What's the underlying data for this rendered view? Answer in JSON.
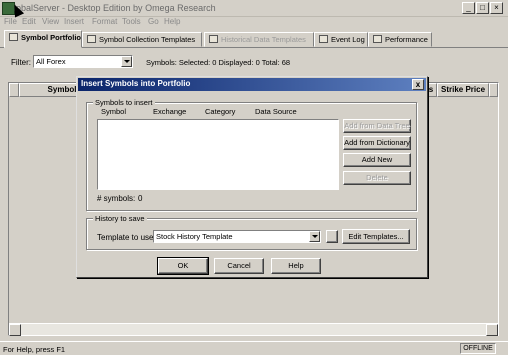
{
  "window": {
    "title": "lobalServer - Desktop Edition by Omega Research"
  },
  "menu": {
    "items": [
      "File",
      "Edit",
      "View",
      "Insert",
      "Format",
      "Tools",
      "Go",
      "Help"
    ]
  },
  "tabs": [
    {
      "label": "Symbol Portfolio",
      "active": true
    },
    {
      "label": "Symbol Collection Templates",
      "active": false
    },
    {
      "label": "Historical Data Templates",
      "active": false
    },
    {
      "label": "Event Log",
      "active": false
    },
    {
      "label": "Performance",
      "active": false
    }
  ],
  "filter": {
    "label": "Filter:",
    "value": "All Forex",
    "counts": "Symbols: Selected: 0   Displayed: 0   Total: 68"
  },
  "grid": {
    "columns": [
      "Symbol",
      "s",
      "Strike Price"
    ]
  },
  "status": {
    "text": "For Help, press F1",
    "mode": "OFFLINE"
  },
  "dialog": {
    "title": "Insert Symbols into Portfolio",
    "close_label": "x",
    "symbols_group_label": "Symbols to insert",
    "list_columns": [
      "Symbol",
      "Exchange",
      "Category",
      "Data Source"
    ],
    "symbol_count_label": "# symbols:",
    "symbol_count_value": "0",
    "buttons": {
      "add_from_data_tree": "Add from Data Tree",
      "add_from_dictionary": "Add from Dictionary",
      "add_new": "Add New",
      "delete": "Delete"
    },
    "history_group_label": "History to save",
    "template_label": "Template to use:",
    "template_value": "Stock History Template",
    "edit_templates": "Edit Templates...",
    "ok": "OK",
    "cancel": "Cancel",
    "help": "Help"
  },
  "colors": {
    "titlebar_active": "#0a246a",
    "face": "#d4d0c8"
  }
}
